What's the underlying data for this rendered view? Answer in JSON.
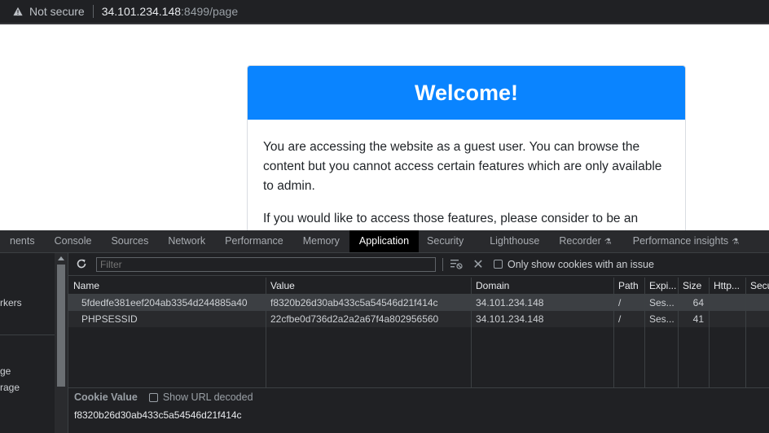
{
  "address_bar": {
    "security_label": "Not secure",
    "host": "34.101.234.148",
    "path": ":8499/page"
  },
  "card": {
    "title": "Welcome!",
    "paragraph1": "You are accessing the website as a guest user. You can browse the content but you cannot access certain features which are only available to admin.",
    "paragraph2": "If you would like to access those features, please consider to be an"
  },
  "devtools": {
    "tabs": [
      {
        "label": "nents"
      },
      {
        "label": "Console"
      },
      {
        "label": "Sources"
      },
      {
        "label": "Network"
      },
      {
        "label": "Performance"
      },
      {
        "label": "Memory"
      },
      {
        "label": "Application"
      },
      {
        "label": "Security"
      },
      {
        "label": "Lighthouse"
      },
      {
        "label": "Recorder"
      },
      {
        "label": "Performance insights"
      }
    ],
    "active_tab": "Application",
    "sidebar_items": [
      {
        "label": "rkers"
      },
      {
        "label": "ge"
      },
      {
        "label": "rage"
      }
    ],
    "toolbar": {
      "filter_placeholder": "Filter",
      "only_issue_label": "Only show cookies with an issue"
    },
    "table": {
      "headers": [
        "Name",
        "Value",
        "Domain",
        "Path",
        "Expi...",
        "Size",
        "Http...",
        "Secu"
      ],
      "rows": [
        {
          "name": "5fdedfe381eef204ab3354d244885a40",
          "value": "f8320b26d30ab433c5a54546d21f414c",
          "domain": "34.101.234.148",
          "path": "/",
          "expires": "Ses...",
          "size": "64"
        },
        {
          "name": "PHPSESSID",
          "value": "22cfbe0d736d2a2a2a67f4a802956560",
          "domain": "34.101.234.148",
          "path": "/",
          "expires": "Ses...",
          "size": "41"
        }
      ]
    },
    "cookie_value": {
      "title": "Cookie Value",
      "decode_label": "Show URL decoded",
      "value": "f8320b26d30ab433c5a54546d21f414c"
    }
  },
  "colors": {
    "card_header": "#0a84ff",
    "devtools_bg": "#202124",
    "active_tab_bg": "#000000"
  }
}
